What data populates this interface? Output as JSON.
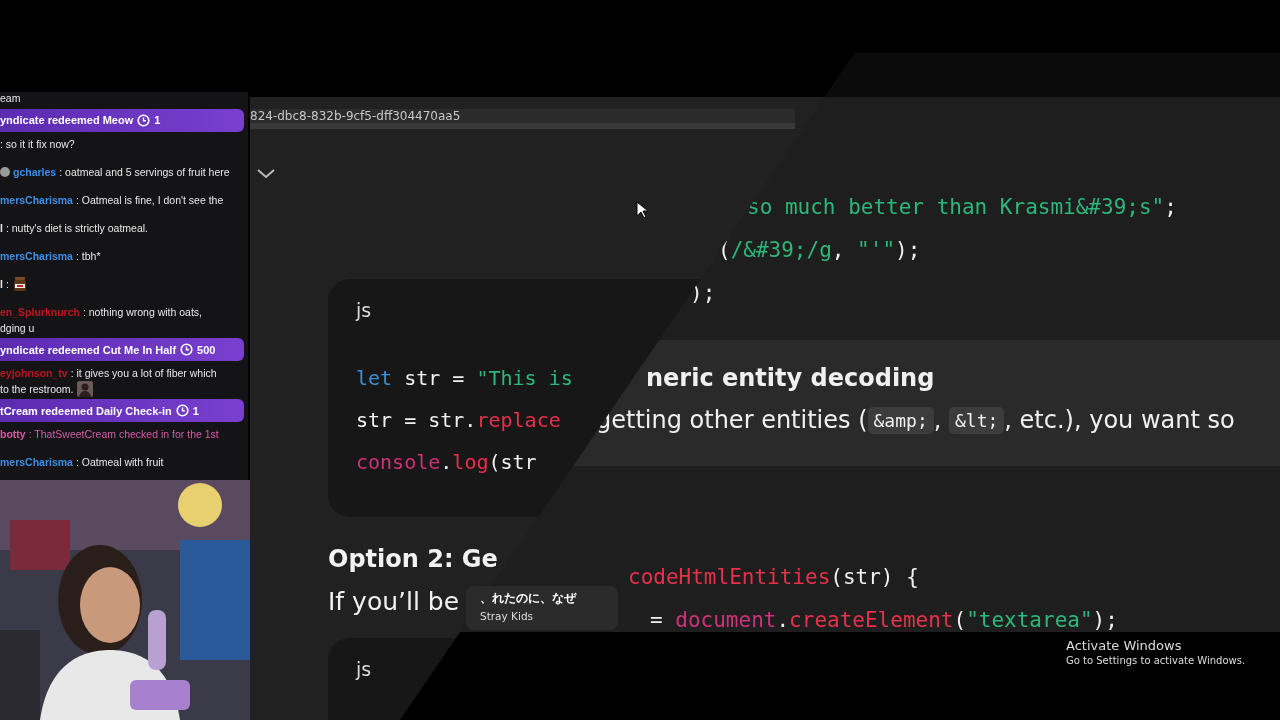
{
  "chat": {
    "items": [
      {
        "kind": "fragment",
        "text": "eam"
      },
      {
        "kind": "redemption",
        "text": "yndicate redeemed Meow",
        "cost": "1"
      },
      {
        "kind": "message",
        "text": ": so it it fix now?"
      },
      {
        "kind": "message",
        "badge": true,
        "user": "gcharles",
        "color": "#3b8ee8",
        "text": ": oatmeal and 5 servings of fruit here"
      },
      {
        "kind": "message",
        "user": "mersCharisma",
        "color": "#3b8ee8",
        "text": ": Oatmeal is fine, I don't see the"
      },
      {
        "kind": "message",
        "user": "l",
        "color": "#e8e8e8",
        "text": ": nutty's diet is strictly oatmeal."
      },
      {
        "kind": "message",
        "user": "mersCharisma",
        "color": "#3b8ee8",
        "text": ": tbh*"
      },
      {
        "kind": "message",
        "user": "l",
        "color": "#e8e8e8",
        "text": ":",
        "emote": {
          "kind": "jar"
        }
      },
      {
        "kind": "message",
        "user": "en_Splurknurch",
        "color": "#c0141d",
        "text": ": nothing wrong with oats,",
        "text_2": "dging u"
      },
      {
        "kind": "redemption",
        "text": "yndicate redeemed Cut Me In Half",
        "cost": "500"
      },
      {
        "kind": "message",
        "user": "eyjohnson_tv",
        "color": "#c0141d",
        "text": ": it gives you a lot of fiber which",
        "text_2": "to the restroom."
      },
      {
        "kind": "redemption",
        "text": "tCream redeemed Daily Check-in",
        "cost": "1"
      },
      {
        "kind": "notice",
        "user": "botty",
        "color": "#d45aa8",
        "text": ": ThatSweetCream checked in for the 1st"
      },
      {
        "kind": "message",
        "user": "mersCharisma",
        "color": "#3b8ee8",
        "text": ": Oatmeal with fruit"
      }
    ]
  },
  "browser": {
    "url": "824-dbc8-832b-9cf5-dff304470aa5",
    "code_block": {
      "language": "js",
      "lines": [
        [
          {
            "kind": "keyword",
            "text": "let"
          },
          {
            "kind": "plain",
            "text": " str = "
          },
          {
            "kind": "string",
            "text": "\"This is "
          }
        ],
        [
          {
            "kind": "plain",
            "text": "str = str."
          },
          {
            "kind": "func",
            "text": "replace"
          }
        ],
        [
          {
            "kind": "object",
            "text": "console"
          },
          {
            "kind": "plain",
            "text": "."
          },
          {
            "kind": "func",
            "text": "log"
          },
          {
            "kind": "plain",
            "text": "(str"
          }
        ]
      ]
    },
    "heading": "Option 2: Ge",
    "paragraph": "If you’ll be",
    "code_block_2": {
      "language": "js"
    }
  },
  "overlay": {
    "code_lines": [
      [
        {
          "kind": "string",
          "text": "so much better than Krasmi&#39;s\""
        },
        {
          "kind": "plain",
          "text": ";"
        }
      ],
      [
        {
          "kind": "plain",
          "text": "("
        },
        {
          "kind": "string",
          "text": "/&#39;/g"
        },
        {
          "kind": "plain",
          "text": ", "
        },
        {
          "kind": "string",
          "text": "\"'\""
        },
        {
          "kind": "plain",
          "text": ");"
        }
      ],
      [
        {
          "kind": "plain",
          "text": ");"
        }
      ]
    ],
    "heading": "neric entity decoding",
    "paragraph": [
      {
        "kind": "text",
        "text": "getting other entities ("
      },
      {
        "kind": "code",
        "text": "&amp;"
      },
      {
        "kind": "text",
        "text": ", "
      },
      {
        "kind": "code",
        "text": "&lt;"
      },
      {
        "kind": "text",
        "text": ", etc.), you want so"
      }
    ],
    "code_lines_2": [
      [
        {
          "kind": "func",
          "text": "codeHtmlEntities"
        },
        {
          "kind": "plain",
          "text": "(str) {"
        }
      ],
      [
        {
          "kind": "plain",
          "text": "= "
        },
        {
          "kind": "object",
          "text": "document"
        },
        {
          "kind": "plain",
          "text": "."
        },
        {
          "kind": "func",
          "text": "createElement"
        },
        {
          "kind": "plain",
          "text": "("
        },
        {
          "kind": "string",
          "text": "\"textarea\""
        },
        {
          "kind": "plain",
          "text": ");"
        }
      ]
    ],
    "popup": {
      "title": "、れたのに、なぜ",
      "subtitle": "Stray Kids"
    },
    "activation": {
      "title": "Activate Windows",
      "text": "Go to Settings to activate Windows."
    }
  }
}
